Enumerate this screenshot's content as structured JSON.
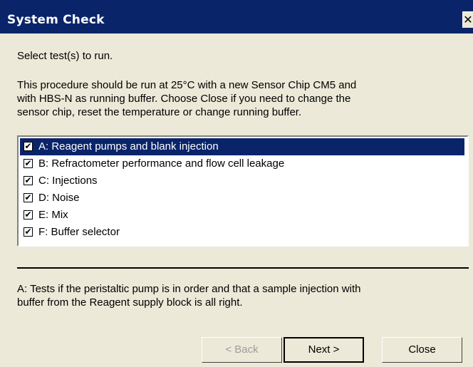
{
  "window": {
    "title": "System Check",
    "close_glyph": "✕"
  },
  "prompt": "Select test(s) to run.",
  "description_lines": [
    "This procedure should be run at 25°C with a new Sensor Chip CM5 and",
    "with HBS-N as running buffer. Choose Close if you need to change the",
    "sensor chip, reset the temperature or change running buffer."
  ],
  "tests": [
    {
      "label": "A: Reagent pumps and blank injection",
      "checked": true,
      "selected": true
    },
    {
      "label": "B: Refractometer performance and flow cell leakage",
      "checked": true,
      "selected": false
    },
    {
      "label": "C: Injections",
      "checked": true,
      "selected": false
    },
    {
      "label": "D: Noise",
      "checked": true,
      "selected": false
    },
    {
      "label": "E: Mix",
      "checked": true,
      "selected": false
    },
    {
      "label": "F: Buffer selector",
      "checked": true,
      "selected": false
    }
  ],
  "help_lines": [
    "A: Tests if the peristaltic pump is in order and that a sample injection with",
    "buffer from the Reagent supply block is all right."
  ],
  "buttons": {
    "back": "< Back",
    "next": "Next >",
    "close": "Close"
  },
  "check_glyph": "✔",
  "colors": {
    "title_bar": "#0a246a",
    "selection": "#0a246a",
    "dialog_face": "#ece9d8"
  }
}
